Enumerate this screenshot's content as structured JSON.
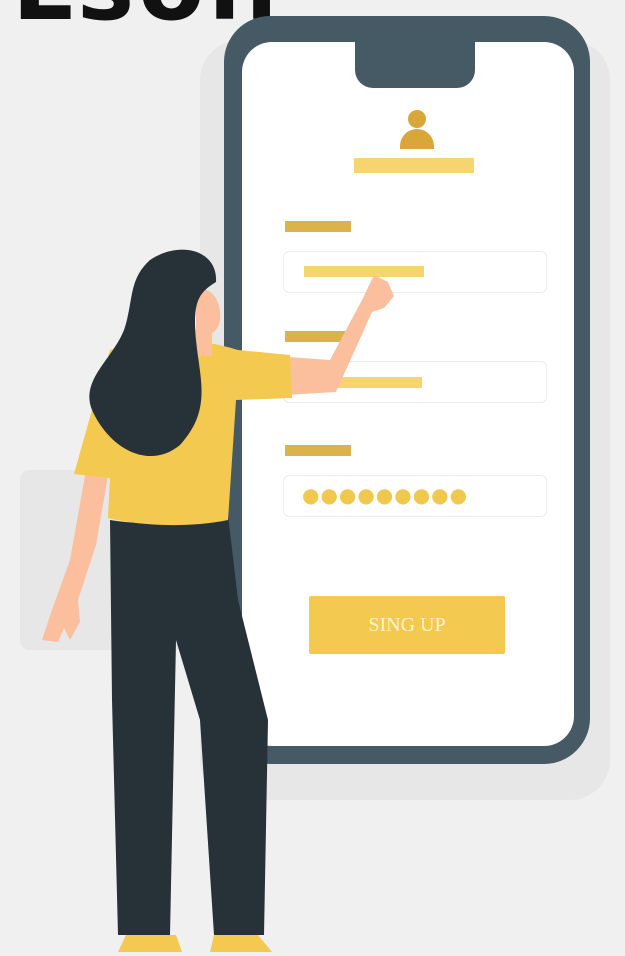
{
  "heading_fragment": "Lsoll",
  "form": {
    "signup_label": "SING UP",
    "password_mask": "●●●●●●●●●"
  },
  "colors": {
    "phone_frame": "#455a64",
    "accent": "#f4c94f",
    "hair": "#263238",
    "skin": "#fbbf9e",
    "pants": "#263238"
  }
}
